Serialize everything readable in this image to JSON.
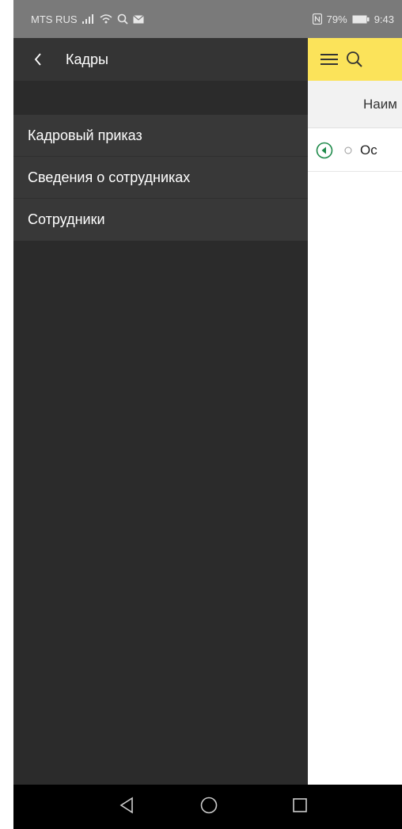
{
  "status_bar": {
    "carrier": "MTS RUS",
    "battery": "79%",
    "time": "9:43"
  },
  "drawer": {
    "title": "Кадры",
    "items": [
      {
        "label": "Кадровый приказ"
      },
      {
        "label": "Сведения о сотрудниках"
      },
      {
        "label": "Сотрудники"
      }
    ]
  },
  "background_app": {
    "column_header": "Наим",
    "row_text": "Ос",
    "colors": {
      "header_bg": "#fbe35a",
      "play_accent": "#1e8a4a"
    }
  },
  "icons": {
    "signal": "signal-icon",
    "wifi": "wifi-icon",
    "search_status": "search-icon",
    "mail": "mail-icon",
    "nfc": "nfc-icon",
    "battery": "battery-icon",
    "back": "chevron-left-icon",
    "menu": "hamburger-icon",
    "search": "search-icon",
    "nav_back": "triangle-back-icon",
    "nav_home": "circle-home-icon",
    "nav_recents": "square-recents-icon"
  }
}
